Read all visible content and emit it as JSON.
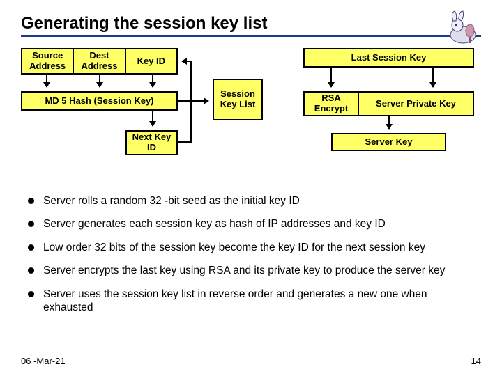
{
  "title": "Generating the session key list",
  "diagram": {
    "source_address": "Source Address",
    "dest_address": "Dest Address",
    "key_id": "Key ID",
    "md5_hash": "MD 5 Hash (Session Key)",
    "next_key_id": "Next Key ID",
    "session_key_list": "Session Key List",
    "last_session_key": "Last Session Key",
    "rsa_encrypt": "RSA Encrypt",
    "server_private_key": "Server Private Key",
    "server_key": "Server Key"
  },
  "bullets": [
    "Server rolls a random 32 -bit seed as the initial key ID",
    "Server generates each session key as hash of IP addresses and key ID",
    "Low order 32 bits of the session key become the key ID for the next session key",
    "Server encrypts the last key using RSA and its private key to produce the server key",
    "Server uses the session key list in reverse order and generates a new one when exhausted"
  ],
  "footer": {
    "date": "06 -Mar-21",
    "page": "14"
  }
}
